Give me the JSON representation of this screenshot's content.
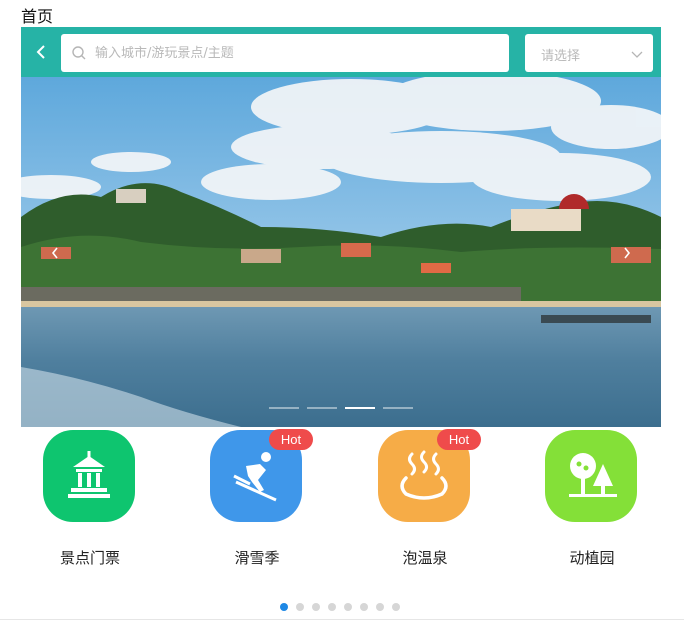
{
  "page": {
    "title": "首页"
  },
  "topbar": {
    "search_placeholder": "输入城市/游玩景点/主题",
    "select_placeholder": "请选择",
    "accent": "#26b3a6"
  },
  "banner": {
    "slides_total": 4,
    "active_slide": 3,
    "icons": {
      "prev": "chevron-left-icon",
      "next": "chevron-right-icon"
    }
  },
  "categories": [
    {
      "label": "景点门票",
      "icon": "pavilion-icon",
      "color": "#0ec56f",
      "badge": ""
    },
    {
      "label": "滑雪季",
      "icon": "skier-icon",
      "color": "#3f97ea",
      "badge": "Hot"
    },
    {
      "label": "泡温泉",
      "icon": "hot-spring-icon",
      "color": "#f6ac47",
      "badge": "Hot"
    },
    {
      "label": "动植园",
      "icon": "trees-icon",
      "color": "#84e038",
      "badge": ""
    }
  ],
  "pager": {
    "pages_total": 8,
    "active_page": 1
  }
}
